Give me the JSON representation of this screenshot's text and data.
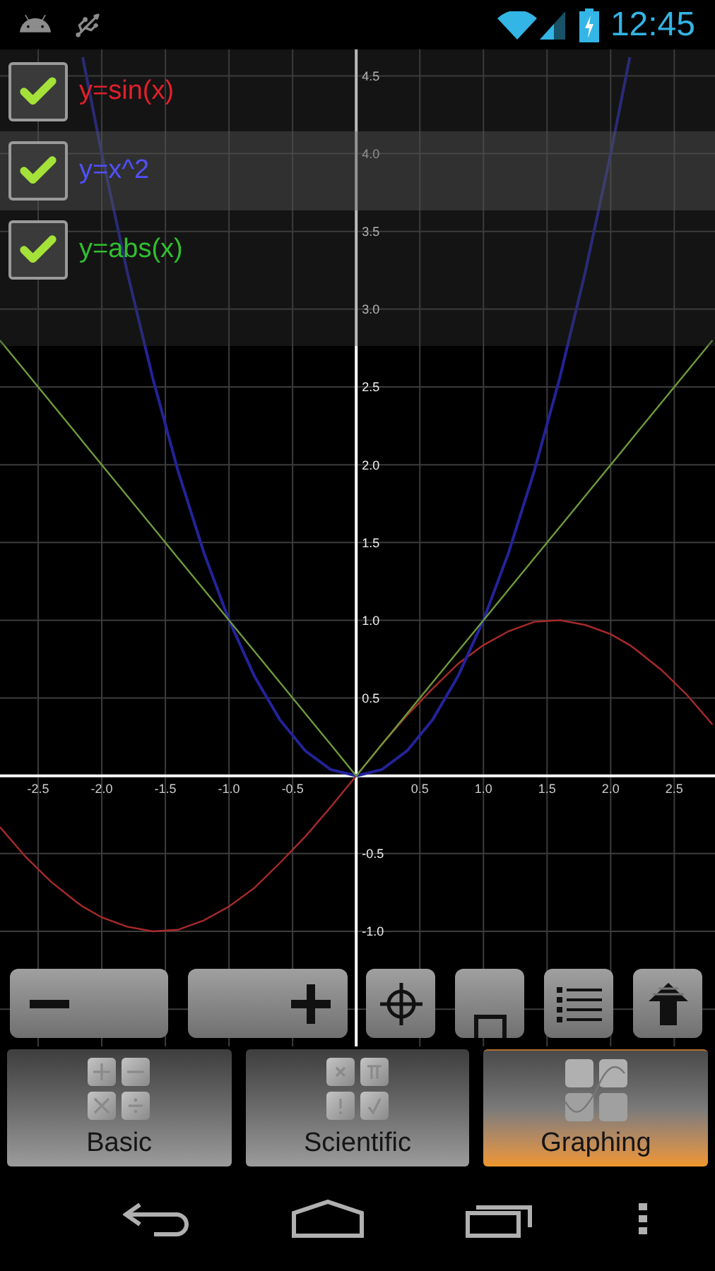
{
  "status_bar": {
    "time": "12:45"
  },
  "functions": [
    {
      "label": "y=sin(x)",
      "color": "#e0202a",
      "checked": true,
      "selected": false
    },
    {
      "label": "y=x^2",
      "color": "#5050ff",
      "checked": true,
      "selected": true
    },
    {
      "label": "y=abs(x)",
      "color": "#30c030",
      "checked": true,
      "selected": false
    }
  ],
  "graph": {
    "chart_data": {
      "type": "line",
      "grid": true,
      "x": [
        -2.8,
        -2.6,
        -2.4,
        -2.2,
        -2.15,
        -2.0,
        -1.8,
        -1.6,
        -1.4,
        -1.2,
        -1.0,
        -0.8,
        -0.6,
        -0.4,
        -0.2,
        0,
        0.2,
        0.4,
        0.6,
        0.8,
        1.0,
        1.2,
        1.4,
        1.6,
        1.8,
        2.0,
        2.15,
        2.2,
        2.4,
        2.6,
        2.8
      ],
      "series": [
        {
          "color": "#a82a2a",
          "values": [
            -0.33,
            -0.52,
            -0.68,
            -0.81,
            -0.84,
            -0.91,
            -0.97,
            -1.0,
            -0.99,
            -0.93,
            -0.84,
            -0.72,
            -0.56,
            -0.39,
            -0.2,
            0,
            0.2,
            0.39,
            0.56,
            0.72,
            0.84,
            0.93,
            0.99,
            1.0,
            0.97,
            0.91,
            0.84,
            0.81,
            0.68,
            0.52,
            0.33
          ]
        },
        {
          "color": "#23239a",
          "values": [
            null,
            null,
            null,
            null,
            4.62,
            4.0,
            3.24,
            2.56,
            1.96,
            1.44,
            1.0,
            0.64,
            0.36,
            0.16,
            0.04,
            0,
            0.04,
            0.16,
            0.36,
            0.64,
            1.0,
            1.44,
            1.96,
            2.56,
            3.24,
            4.0,
            4.62,
            null,
            null,
            null,
            null
          ]
        },
        {
          "color": "#6f9a3c",
          "values": [
            2.8,
            2.6,
            2.4,
            2.2,
            2.15,
            2.0,
            1.8,
            1.6,
            1.4,
            1.2,
            1.0,
            0.8,
            0.6,
            0.4,
            0.2,
            0,
            0.2,
            0.4,
            0.6,
            0.8,
            1.0,
            1.2,
            1.4,
            1.6,
            1.8,
            2.0,
            2.15,
            2.2,
            2.4,
            2.6,
            2.8
          ]
        }
      ],
      "xlim": [
        -2.8,
        2.82
      ],
      "ylim": [
        -1.74,
        4.67
      ],
      "xticks": [
        {
          "value": -2.5,
          "label": "-2.5"
        },
        {
          "value": -2.0,
          "label": "-2.0"
        },
        {
          "value": -1.5,
          "label": "-1.5"
        },
        {
          "value": -1.0,
          "label": "-1.0"
        },
        {
          "value": -0.5,
          "label": "-0.5"
        },
        {
          "value": 0.5,
          "label": "0.5"
        },
        {
          "value": 1.0,
          "label": "1.0"
        },
        {
          "value": 1.5,
          "label": "1.5"
        },
        {
          "value": 2.0,
          "label": "2.0"
        },
        {
          "value": 2.5,
          "label": "2.5"
        }
      ],
      "yticks": [
        {
          "value": -1.0,
          "label": "-1.0"
        },
        {
          "value": -0.5,
          "label": "-0.5"
        },
        {
          "value": 0.5,
          "label": "0.5"
        },
        {
          "value": 1.0,
          "label": "1.0"
        },
        {
          "value": 1.5,
          "label": "1.5"
        },
        {
          "value": 2.0,
          "label": "2.0"
        },
        {
          "value": 2.5,
          "label": "2.5"
        },
        {
          "value": 3.0,
          "label": "3.0"
        },
        {
          "value": 3.5,
          "label": "3.5"
        },
        {
          "value": 4.0,
          "label": "4.0"
        },
        {
          "value": 4.5,
          "label": "4.5"
        }
      ]
    }
  },
  "tabs": [
    {
      "label": "Basic",
      "selected": false
    },
    {
      "label": "Scientific",
      "selected": false
    },
    {
      "label": "Graphing",
      "selected": true
    }
  ]
}
